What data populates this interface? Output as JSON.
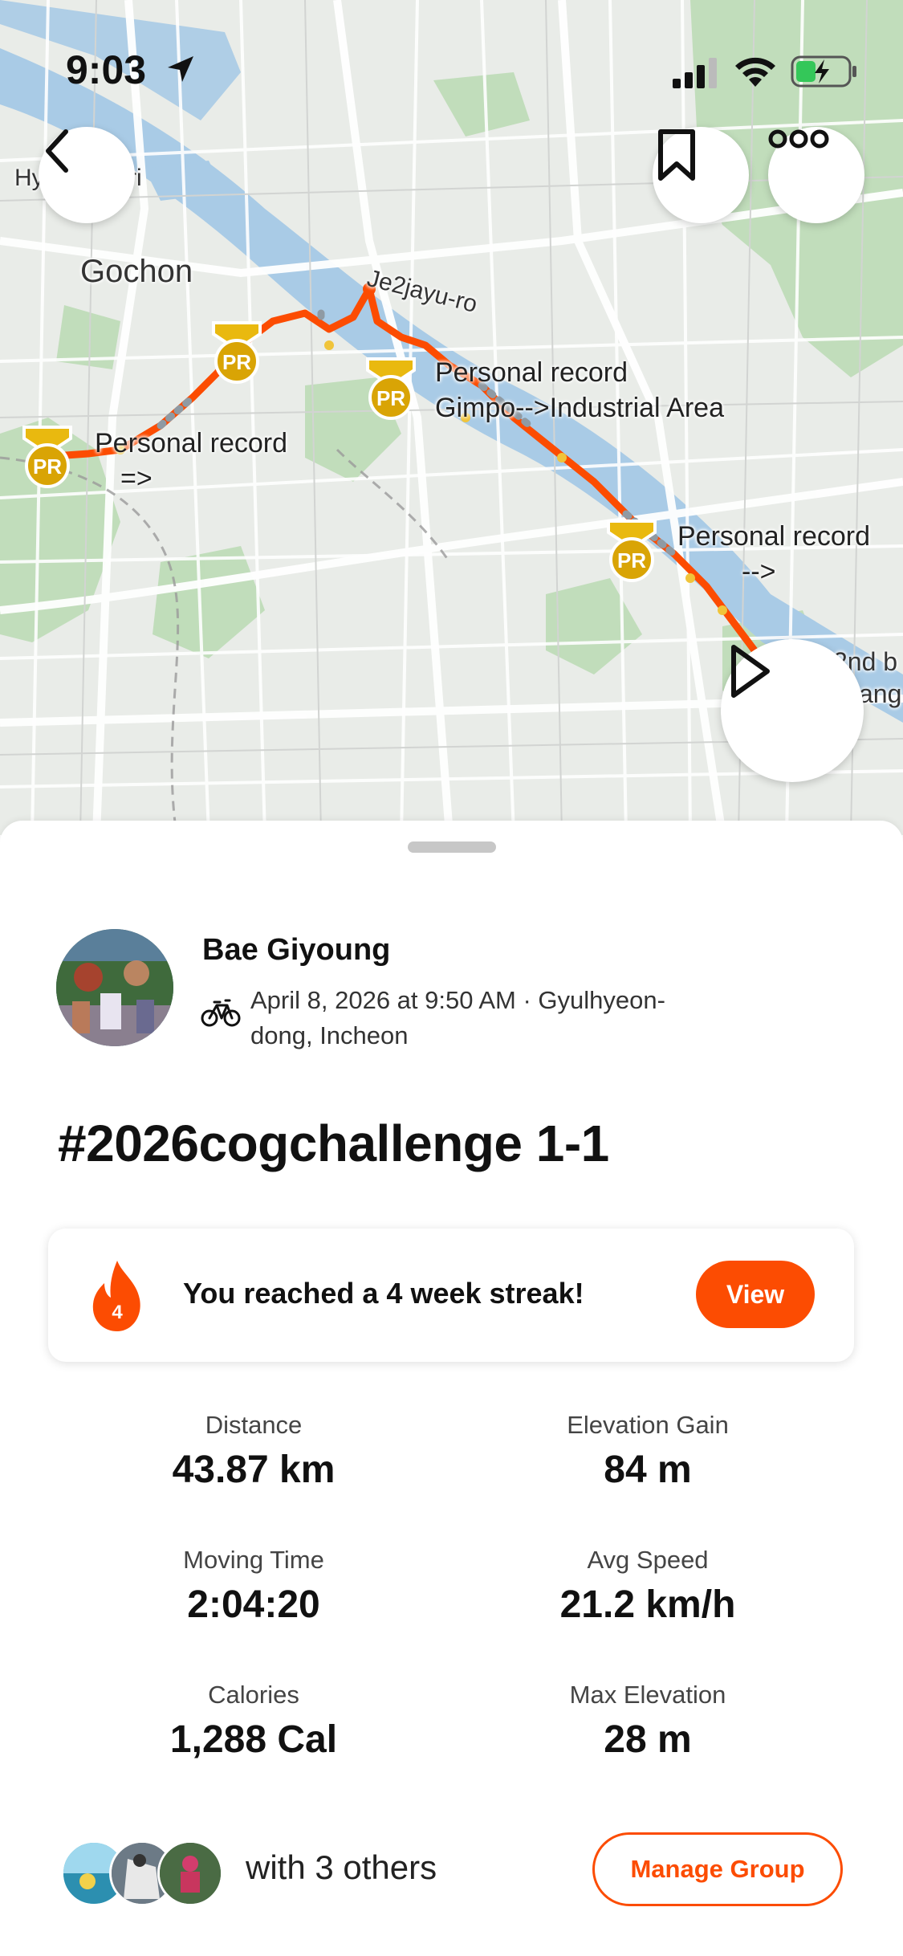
{
  "status_bar": {
    "time": "9:03"
  },
  "map": {
    "labels": {
      "hy_ri_left": "Hy",
      "hy_ri_right": "-ri",
      "gochon": "Gochon",
      "je2jayu_ro": "Je2jayu-ro",
      "second_b": "2nd b",
      "ang": "ang"
    },
    "pr_badge_text": "PR",
    "personal_records": [
      {
        "title": "Personal record",
        "segment": "=>"
      },
      {
        "title": "Personal record",
        "segment": "Gimpo-->Industrial Area"
      },
      {
        "title": "Personal record",
        "segment": "-->"
      }
    ]
  },
  "activity": {
    "athlete_name": "Bae Giyoung",
    "date_location": "April 8, 2026 at 9:50 AM · Gyulhyeon-dong, Incheon",
    "title": "#2026cogchallenge 1-1"
  },
  "streak": {
    "flame_number": "4",
    "message": "You reached a 4 week streak!",
    "button_label": "View"
  },
  "stats": [
    {
      "label": "Distance",
      "value": "43.87 km"
    },
    {
      "label": "Elevation Gain",
      "value": "84 m"
    },
    {
      "label": "Moving Time",
      "value": "2:04:20"
    },
    {
      "label": "Avg Speed",
      "value": "21.2 km/h"
    },
    {
      "label": "Calories",
      "value": "1,288 Cal"
    },
    {
      "label": "Max Elevation",
      "value": "28 m"
    }
  ],
  "group": {
    "text": "with 3 others",
    "button_label": "Manage Group"
  },
  "colors": {
    "brand": "#fc4c02",
    "pr_gold": "#e9b90f",
    "river": "#a9cbe6",
    "park": "#b9dbb4"
  },
  "icons": [
    "navigation-arrow-icon",
    "signal-icon",
    "wifi-icon",
    "battery-charging-icon",
    "back-chevron-icon",
    "bookmark-icon",
    "more-icon",
    "play-icon",
    "bike-icon",
    "flame-icon"
  ]
}
